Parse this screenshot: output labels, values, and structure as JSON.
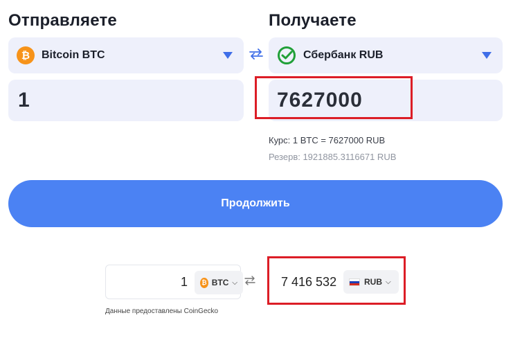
{
  "send": {
    "title": "Отправляете",
    "currency": "Bitcoin BTC",
    "currency_icon": "btc-coin-icon",
    "amount": "1"
  },
  "receive": {
    "title": "Получаете",
    "currency": "Сбербанк RUB",
    "currency_icon": "sberbank-logo-icon",
    "amount": "7627000"
  },
  "rate_text": "Курс: 1 BTC = 7627000 RUB",
  "reserve_text": "Резерв: 1921885.3116671 RUB",
  "continue_label": "Продолжить",
  "widget": {
    "send_amount": "1",
    "send_currency": "BTC",
    "receive_amount": "7 416 532",
    "receive_currency": "RUB",
    "credit": "Данные предоставлены CoinGecko"
  },
  "colors": {
    "accent": "#4b82f3",
    "highlight": "#dc1d26",
    "btc": "#f7931a",
    "sber": "#21a038",
    "field_bg": "#eef0fb"
  }
}
